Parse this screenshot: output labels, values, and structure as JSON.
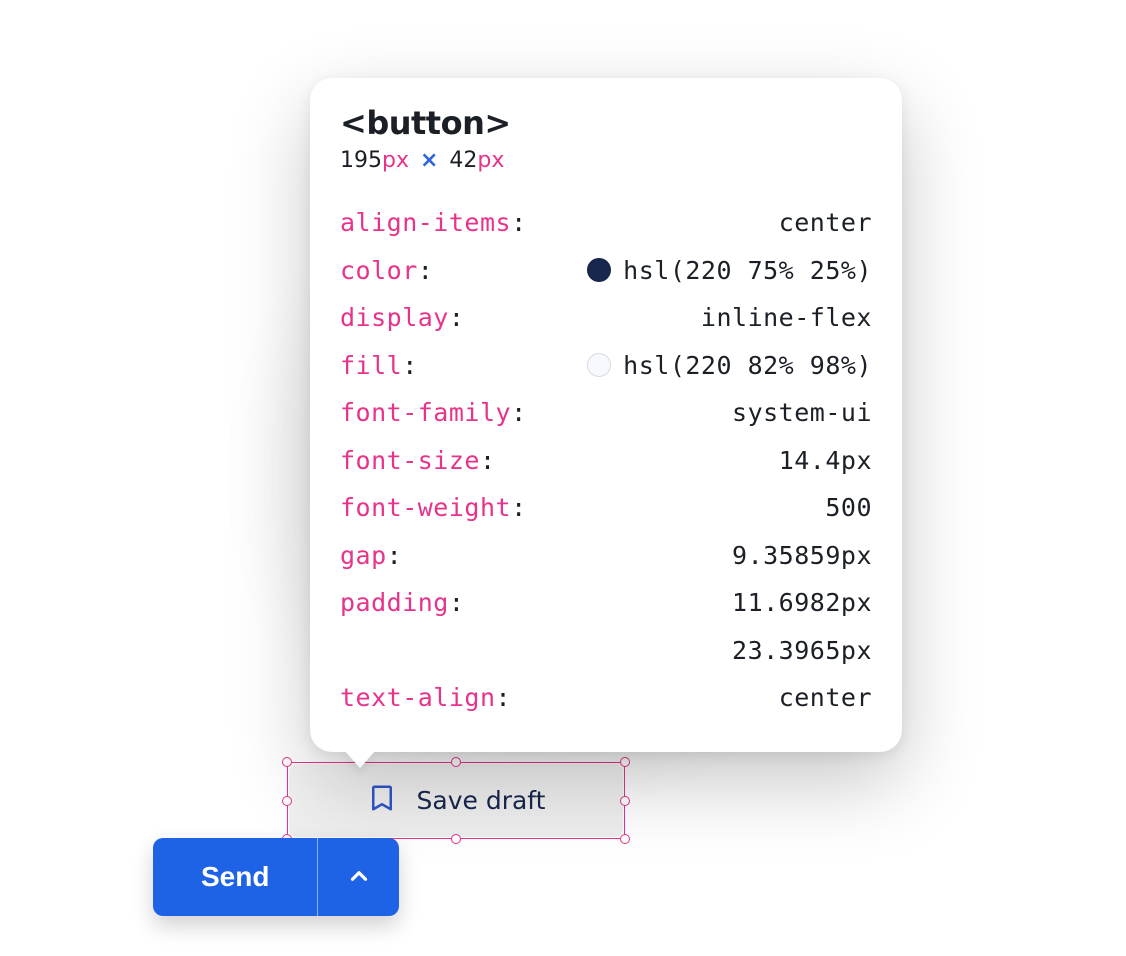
{
  "inspector": {
    "element_tag": "<button>",
    "dimensions": {
      "w_num": "195",
      "w_unit": "px",
      "h_num": "42",
      "h_unit": "px"
    },
    "properties": [
      {
        "name": "align-items",
        "value": "center"
      },
      {
        "name": "color",
        "value": "hsl(220 75% 25%)",
        "swatch": "#17274e"
      },
      {
        "name": "display",
        "value": "inline-flex"
      },
      {
        "name": "fill",
        "value": "hsl(220 82% 98%)",
        "swatch": "#f6f9fe"
      },
      {
        "name": "font-family",
        "value": "system-ui"
      },
      {
        "name": "font-size",
        "value": "14.4px"
      },
      {
        "name": "font-weight",
        "value": "500"
      },
      {
        "name": "gap",
        "value": "9.35859px"
      },
      {
        "name": "padding",
        "value": "11.6982px",
        "value2": "23.3965px"
      },
      {
        "name": "text-align",
        "value": "center"
      }
    ]
  },
  "target_button": {
    "label": "Save draft"
  },
  "send": {
    "label": "Send"
  }
}
